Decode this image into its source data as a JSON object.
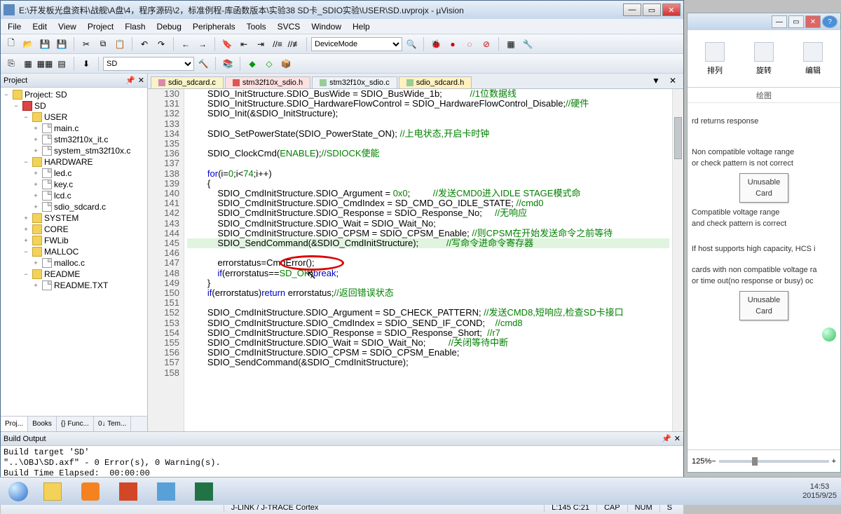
{
  "window": {
    "title": "E:\\开发板光盘资料\\战舰\\A盘\\4，程序源码\\2，标准例程-库函数版本\\实验38 SD卡_SDIO实验\\USER\\SD.uvprojx - µVision"
  },
  "menu": [
    "File",
    "Edit",
    "View",
    "Project",
    "Flash",
    "Debug",
    "Peripherals",
    "Tools",
    "SVCS",
    "Window",
    "Help"
  ],
  "toolbar": {
    "device_mode": "DeviceMode",
    "target_combo": "SD"
  },
  "project_panel": {
    "title": "Project",
    "root": "Project: SD",
    "target": "SD",
    "groups": [
      {
        "name": "USER",
        "files": [
          "main.c",
          "stm32f10x_it.c",
          "system_stm32f10x.c"
        ]
      },
      {
        "name": "HARDWARE",
        "files": [
          "led.c",
          "key.c",
          "lcd.c",
          "sdio_sdcard.c"
        ]
      },
      {
        "name": "SYSTEM",
        "files": []
      },
      {
        "name": "CORE",
        "files": []
      },
      {
        "name": "FWLib",
        "files": []
      },
      {
        "name": "MALLOC",
        "files": [
          "malloc.c"
        ]
      },
      {
        "name": "README",
        "files": [
          "README.TXT"
        ]
      }
    ],
    "bottom_tabs": [
      "Proj...",
      "Books",
      "{} Func...",
      "0↓ Tem..."
    ]
  },
  "file_tabs": [
    {
      "name": "sdio_sdcard.c",
      "state": "modified"
    },
    {
      "name": "stm32f10x_sdio.h",
      "state": "active"
    },
    {
      "name": "stm32f10x_sdio.c",
      "state": "inactive"
    },
    {
      "name": "sdio_sdcard.h",
      "state": "inactive"
    }
  ],
  "code": {
    "first_line": 130,
    "lines": [
      "        SDIO_InitStructure.SDIO_BusWide = SDIO_BusWide_1b;           //1位数据线",
      "        SDIO_InitStructure.SDIO_HardwareFlowControl = SDIO_HardwareFlowControl_Disable;//硬件",
      "        SDIO_Init(&SDIO_InitStructure);",
      "",
      "        SDIO_SetPowerState(SDIO_PowerState_ON); //上电状态,开启卡时钟",
      "",
      "        SDIO_ClockCmd(ENABLE);//SDIOCK使能",
      "",
      "        for(i=0;i<74;i++)",
      "        {",
      "            SDIO_CmdInitStructure.SDIO_Argument = 0x0;         //发送CMD0进入IDLE STAGE模式命",
      "            SDIO_CmdInitStructure.SDIO_CmdIndex = SD_CMD_GO_IDLE_STATE; //cmd0",
      "            SDIO_CmdInitStructure.SDIO_Response = SDIO_Response_No;     //无响应",
      "            SDIO_CmdInitStructure.SDIO_Wait = SDIO_Wait_No;",
      "            SDIO_CmdInitStructure.SDIO_CPSM = SDIO_CPSM_Enable; //则CPSM在开始发送命令之前等待",
      "            SDIO_SendCommand(&SDIO_CmdInitStructure);           //写命令进命令寄存器",
      "",
      "            errorstatus=CmdError();",
      "            if(errorstatus==SD_OK)break;",
      "        }",
      "        if(errorstatus)return errorstatus;//返回错误状态",
      "",
      "        SDIO_CmdInitStructure.SDIO_Argument = SD_CHECK_PATTERN; //发送CMD8,短响应,检查SD卡接口",
      "        SDIO_CmdInitStructure.SDIO_CmdIndex = SDIO_SEND_IF_COND;    //cmd8",
      "        SDIO_CmdInitStructure.SDIO_Response = SDIO_Response_Short;  //r7",
      "        SDIO_CmdInitStructure.SDIO_Wait = SDIO_Wait_No;         //关闭等待中断",
      "        SDIO_CmdInitStructure.SDIO_CPSM = SDIO_CPSM_Enable;",
      "        SDIO_SendCommand(&SDIO_CmdInitStructure);",
      ""
    ],
    "highlighted_term": "CmdError",
    "cursor_line": 145,
    "cursor_col": 21
  },
  "build_output": {
    "title": "Build Output",
    "lines": [
      "Build target 'SD'",
      "\"..\\OBJ\\SD.axf\" - 0 Error(s), 0 Warning(s).",
      "Build Time Elapsed:  00:00:00"
    ]
  },
  "status_bar": {
    "debugger": "J-LINK / J-TRACE Cortex",
    "pos": "L:145 C:21",
    "caps": "CAP",
    "num": "NUM",
    "s": "S"
  },
  "side_window": {
    "tools": [
      "排列",
      "旋转",
      "编辑"
    ],
    "section_label": "绘图",
    "text_lines": [
      "rd returns response",
      "Non   compatible voltage range",
      "or check pattern is not correct",
      "Compatible voltage range",
      "and check pattern is correct",
      "If host supports high capacity, HCS i",
      "cards with non compatible voltage ra",
      "or time   out(no response or busy) oc"
    ],
    "flow_box": "Unusable Card",
    "zoom": "125%",
    "slider_minus": "−",
    "slider_plus": "+"
  },
  "taskbar": {
    "time": "14:53",
    "date": "2015/9/25"
  },
  "icons": {
    "minimize": "—",
    "maximize": "▭",
    "close": "✕",
    "pin": "📌",
    "dropdown": "▼",
    "back": "←",
    "fwd": "→",
    "new": "🗋",
    "open": "📂",
    "save": "💾",
    "saveall": "💾",
    "cut": "✂",
    "build": "⚙",
    "download": "⬇",
    "debug_red": "●",
    "search": "🔍"
  }
}
